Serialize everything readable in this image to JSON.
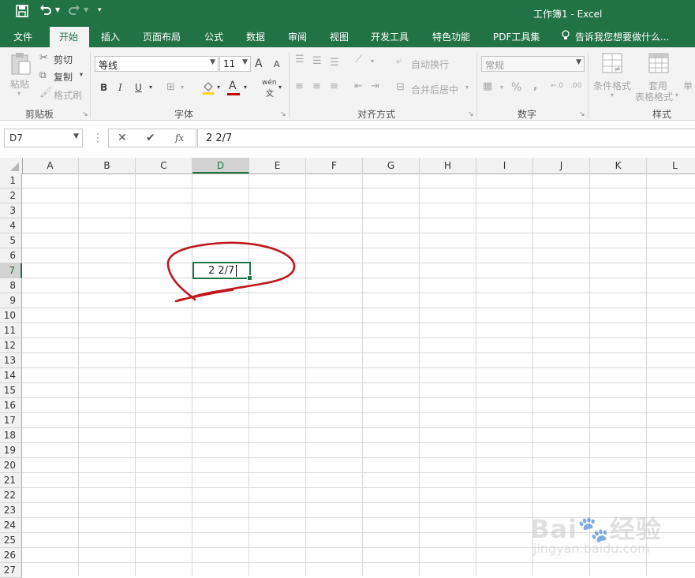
{
  "titlebar": {
    "title": "工作簿1 - Excel",
    "undo_icon": "undo-icon",
    "redo_icon": "redo-icon",
    "save_icon": "save-icon"
  },
  "tabs": [
    "文件",
    "开始",
    "插入",
    "页面布局",
    "公式",
    "数据",
    "审阅",
    "视图",
    "开发工具",
    "特色功能",
    "PDF工具集"
  ],
  "tell_me": "告诉我您想要做什么...",
  "ribbon": {
    "clipboard": {
      "paste": "粘贴",
      "cut": "剪切",
      "copy": "复制",
      "format_painter": "格式刷",
      "label": "剪贴板"
    },
    "font": {
      "name": "等线",
      "size": "11",
      "bold": "B",
      "italic": "I",
      "underline": "U",
      "label": "字体",
      "grow": "A",
      "shrink": "A",
      "font_color": "A",
      "phonetic": "wén"
    },
    "alignment": {
      "wrap": "自动换行",
      "merge": "合并后居中",
      "label": "对齐方式"
    },
    "number": {
      "format": "常规",
      "percent": "%",
      "comma": ",",
      "label": "数字"
    },
    "styles": {
      "conditional": "条件格式",
      "table_format_1": "套用",
      "table_format_2": "表格格式",
      "cell_styles": "单",
      "label": "样式"
    }
  },
  "formula_bar": {
    "name_box": "D7",
    "cancel": "✕",
    "enter": "✔",
    "fx": "fx",
    "formula": "2 2/7"
  },
  "grid": {
    "columns": [
      "A",
      "B",
      "C",
      "D",
      "E",
      "F",
      "G",
      "H",
      "I",
      "J",
      "K",
      "L"
    ],
    "rows": [
      "1",
      "2",
      "3",
      "4",
      "5",
      "6",
      "7",
      "8",
      "9",
      "10",
      "11",
      "12",
      "13",
      "14",
      "15",
      "16",
      "17",
      "18",
      "19",
      "20",
      "21",
      "22",
      "23",
      "24",
      "25",
      "26",
      "27"
    ],
    "selected_column": "D",
    "selected_row": "7",
    "active_cell_value": "2 2/7"
  },
  "colors": {
    "brand": "#217346",
    "annotation": "#c0161c"
  }
}
